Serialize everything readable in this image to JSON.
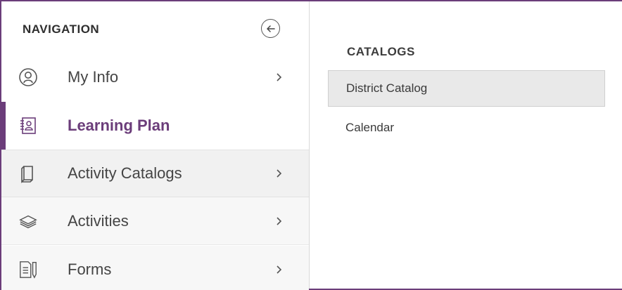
{
  "sidebar": {
    "title": "NAVIGATION",
    "items": [
      {
        "label": "My Info",
        "icon": "user-icon",
        "has_chevron": true
      },
      {
        "label": "Learning Plan",
        "icon": "notebook-contact-icon",
        "active": true
      },
      {
        "label": "Activity Catalogs",
        "icon": "book-icon",
        "has_chevron": true,
        "highlighted": true
      },
      {
        "label": "Activities",
        "icon": "layers-icon",
        "has_chevron": true
      },
      {
        "label": "Forms",
        "icon": "form-pencil-icon",
        "has_chevron": true
      }
    ]
  },
  "submenu": {
    "heading": "CATALOGS",
    "items": [
      {
        "label": "District Catalog",
        "selected": true
      },
      {
        "label": "Calendar"
      }
    ]
  },
  "colors": {
    "accent": "#6b3d7a",
    "hover_bg": "#f1f1f1",
    "selected_bg": "#e9e9e9"
  }
}
